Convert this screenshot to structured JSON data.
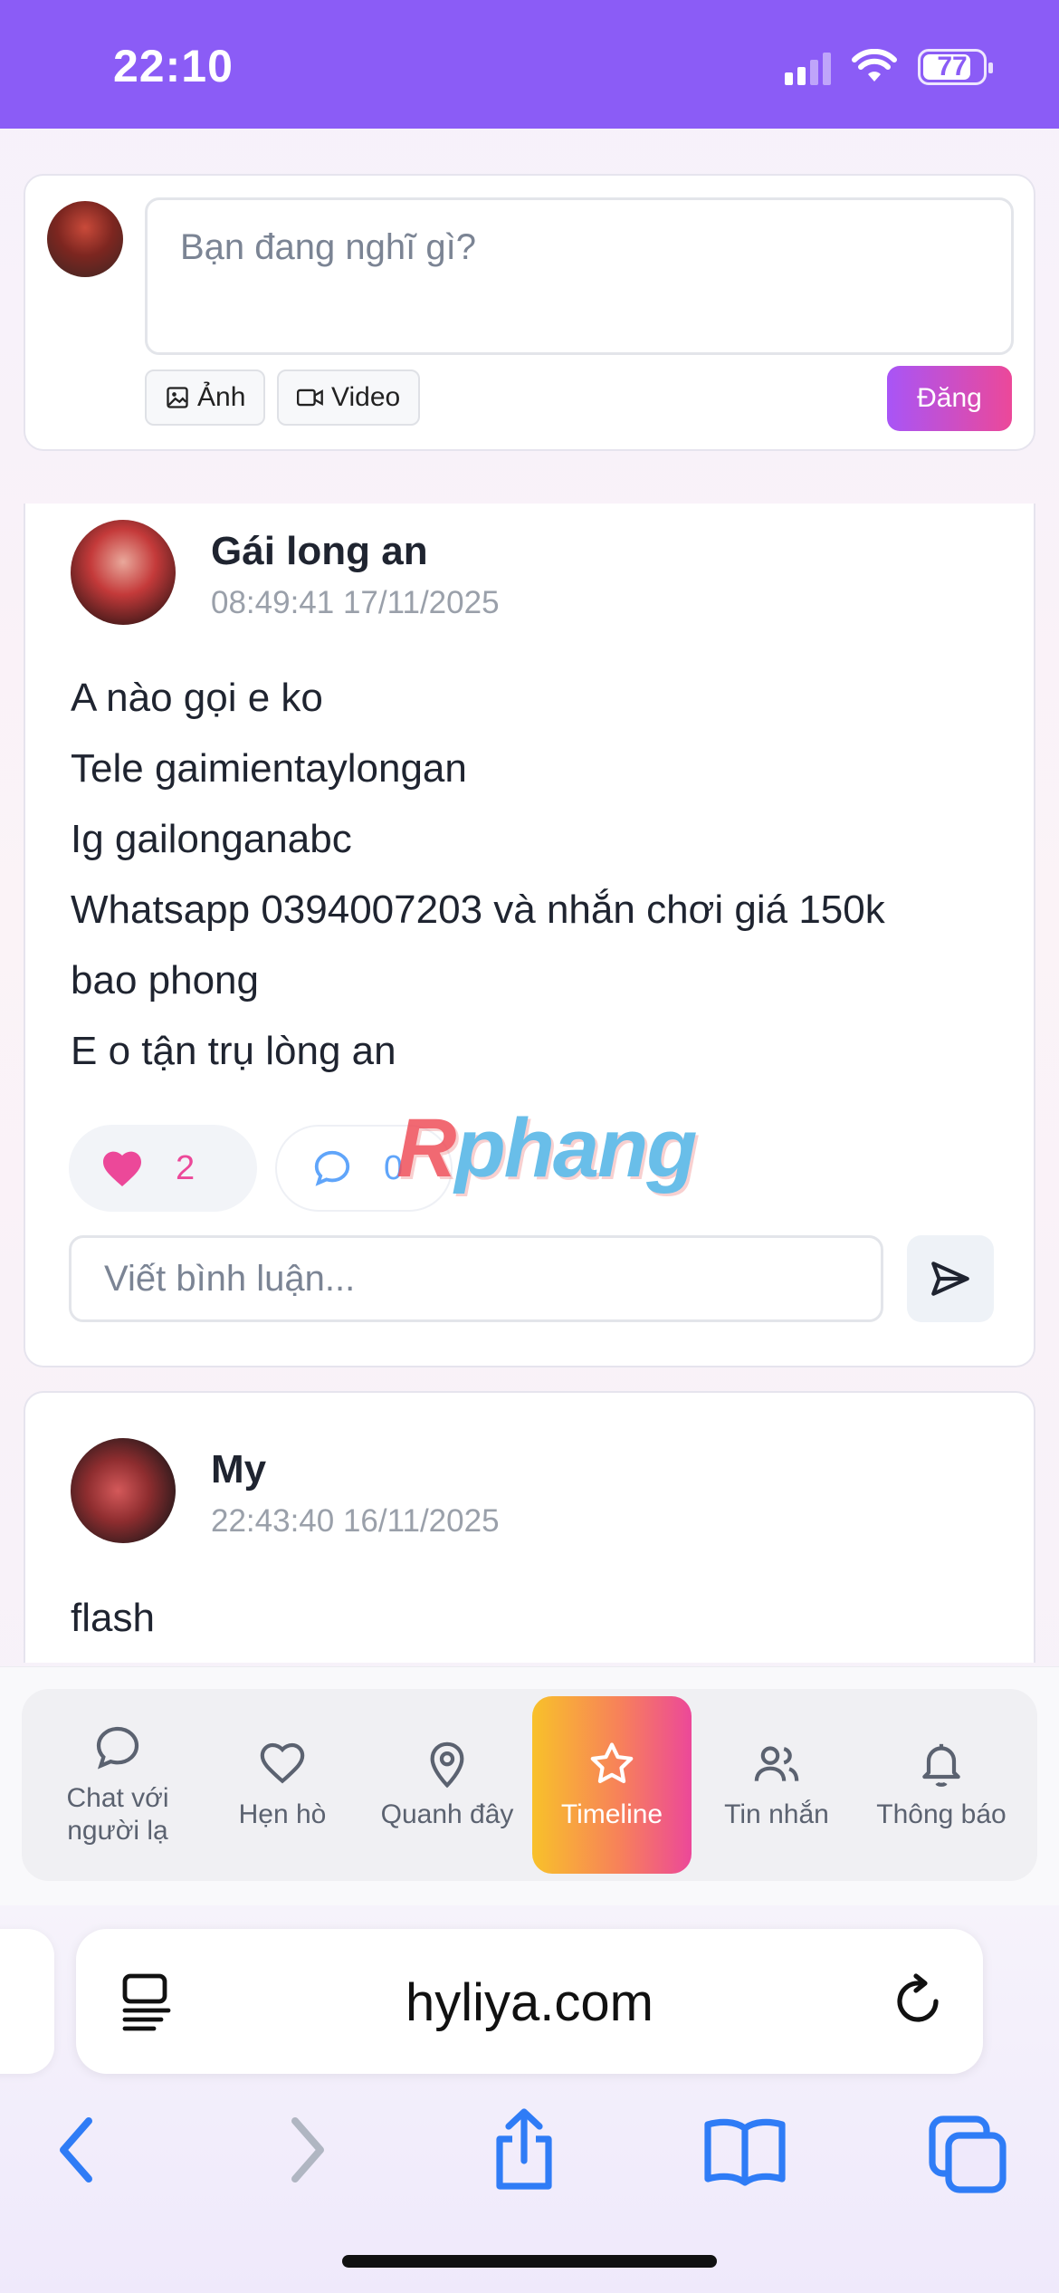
{
  "status_bar": {
    "time": "22:10",
    "battery": "77"
  },
  "composer": {
    "placeholder": "Bạn đang nghĩ gì?",
    "photo_label": "Ảnh",
    "video_label": "Video",
    "post_label": "Đăng"
  },
  "posts": [
    {
      "author": "Gái long an",
      "time": "08:49:41 17/11/2025",
      "lines": [
        "A nào gọi e ko",
        "Tele gaimientaylongan",
        "Ig gailonganabc",
        "Whatsapp 0394007203 và nhắn chơi giá 150k",
        "bao phong",
        "E o tận trụ lòng an"
      ],
      "likes": "2",
      "comments": "0",
      "comment_placeholder": "Viết bình luận..."
    },
    {
      "author": "My",
      "time": "22:43:40 16/11/2025",
      "lines": [
        "flash"
      ]
    }
  ],
  "watermark": {
    "prefix": "R",
    "rest": "phang"
  },
  "bottom_nav": [
    {
      "label": "Chat với người lạ",
      "icon": "chat-bubble-icon"
    },
    {
      "label": "Hẹn hò",
      "icon": "heart-icon"
    },
    {
      "label": "Quanh đây",
      "icon": "map-pin-icon"
    },
    {
      "label": "Timeline",
      "icon": "star-icon",
      "active": true
    },
    {
      "label": "Tin nhắn",
      "icon": "users-icon"
    },
    {
      "label": "Thông báo",
      "icon": "bell-icon"
    }
  ],
  "browser": {
    "url": "hyliya.com"
  },
  "colors": {
    "status_bar": "#8b5cf6",
    "accent_pink": "#ec4899",
    "accent_purple": "#a855f7",
    "safari_blue": "#2f7cf6"
  }
}
